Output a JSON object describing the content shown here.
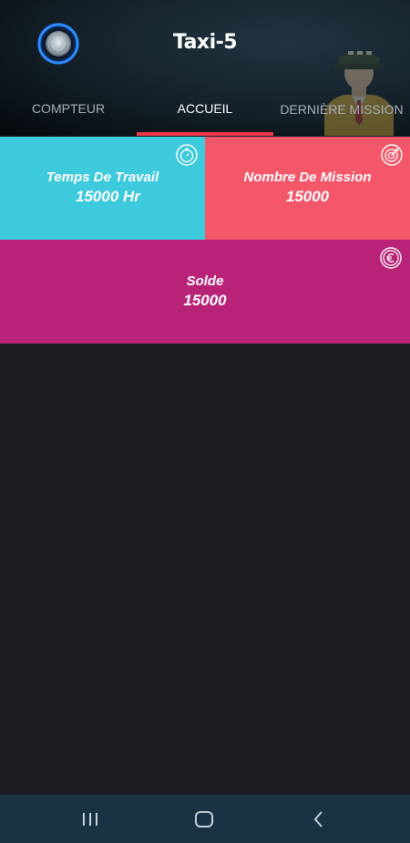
{
  "app": {
    "title": "Taxi-5"
  },
  "tabs": [
    {
      "label": "COMPTEUR",
      "active": false
    },
    {
      "label": "ACCUEIL",
      "active": true
    },
    {
      "label": "DERNIÈRE MISSION",
      "active": false
    }
  ],
  "cards": {
    "temps": {
      "label": "Temps De Travail",
      "value": "15000  Hr",
      "icon": "stopwatch-icon"
    },
    "mission": {
      "label": "Nombre De Mission",
      "value": "15000",
      "icon": "target-icon"
    },
    "solde": {
      "label": "Solde",
      "value": "15000",
      "icon": "euro-icon"
    }
  },
  "colors": {
    "accent": "#f0384e",
    "card_temps": "#3ecadd",
    "card_mission": "#f5576a",
    "card_solde": "#b82377",
    "background": "#1c1e22",
    "navbar": "#1a3344"
  },
  "navbar": {
    "icons": [
      "recent-apps-icon",
      "home-icon",
      "back-icon"
    ]
  }
}
